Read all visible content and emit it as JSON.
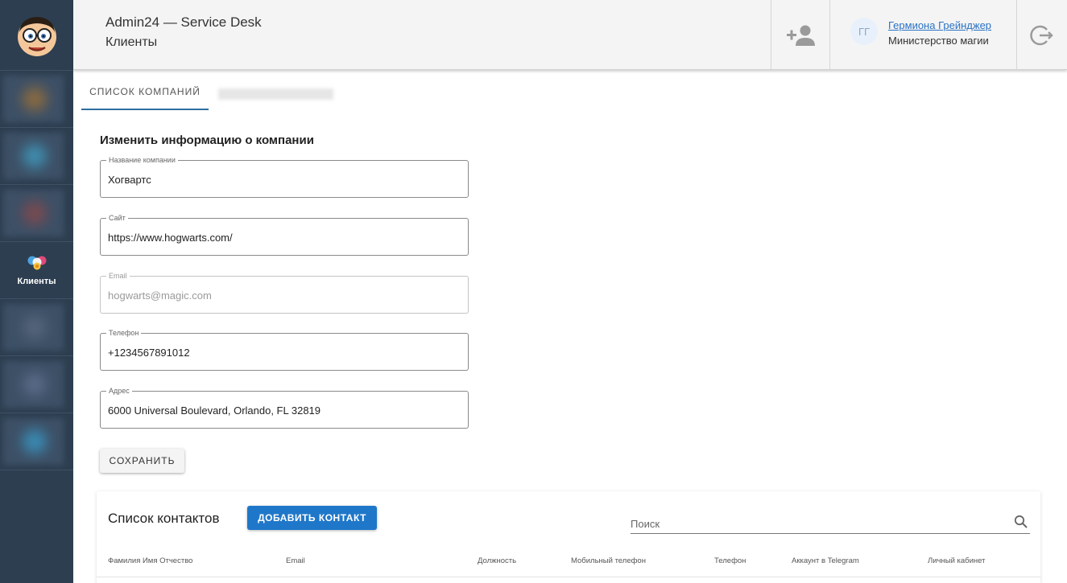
{
  "header": {
    "title": "Admin24 — Service Desk",
    "subtitle": "Клиенты",
    "add_user_icon": "add-user-icon",
    "user": {
      "initials": "ГГ",
      "name": "Гермиона Грейнджер",
      "organization": "Министерство магии"
    },
    "logout_icon": "logout-icon"
  },
  "sidebar": {
    "logo_icon": "cartoon-face-avatar",
    "active_item": {
      "label": "Клиенты",
      "icon": "clients-icon"
    }
  },
  "tabs": {
    "active_label": "СПИСОК КОМПАНИЙ"
  },
  "form": {
    "title": "Изменить информацию о компании",
    "fields": [
      {
        "label": "Название компании",
        "value": "Хогвартс",
        "disabled": false
      },
      {
        "label": "Сайт",
        "value": "https://www.hogwarts.com/",
        "disabled": false
      },
      {
        "label": "Email",
        "value": "hogwarts@magic.com",
        "disabled": true
      },
      {
        "label": "Телефон",
        "value": "+1234567891012",
        "disabled": false
      },
      {
        "label": "Адрес",
        "value": "6000 Universal Boulevard, Orlando, FL 32819",
        "disabled": false
      }
    ],
    "save_label": "СОХРАНИТЬ"
  },
  "contacts": {
    "title": "Список контактов",
    "add_label": "ДОБАВИТЬ КОНТАКТ",
    "search_placeholder": "Поиск",
    "columns": [
      "Фамилия Имя Отчество",
      "Email",
      "Должность",
      "Мобильный телефон",
      "Телефон",
      "Аккаунт в Telegram",
      "Личный кабинет"
    ]
  },
  "colors": {
    "sidebar_bg": "#2d3e50",
    "primary_button": "#1f77c9",
    "link": "#2a72c5",
    "tab_indicator": "#2e6e9e"
  }
}
